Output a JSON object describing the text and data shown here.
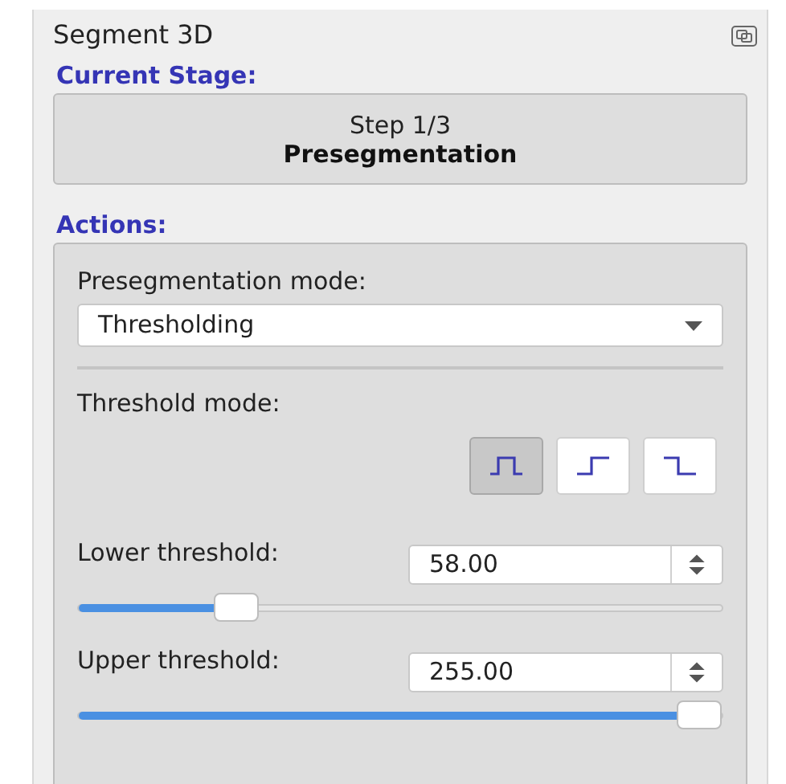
{
  "panel": {
    "title": "Segment 3D"
  },
  "current_stage": {
    "heading": "Current Stage:",
    "step": "Step 1/3",
    "name": "Presegmentation"
  },
  "actions": {
    "heading": "Actions:",
    "mode_label": "Presegmentation mode:",
    "mode_value": "Thresholding",
    "threshold_mode_label": "Threshold mode:",
    "threshold_modes": [
      {
        "kind": "band",
        "selected": true
      },
      {
        "kind": "above",
        "selected": false
      },
      {
        "kind": "below",
        "selected": false
      }
    ],
    "thresholds": [
      {
        "label": "Lower threshold:",
        "value": "58.00",
        "level": 0.227
      },
      {
        "label": "Upper threshold:",
        "value": "255.00",
        "level": 1.0
      }
    ]
  }
}
